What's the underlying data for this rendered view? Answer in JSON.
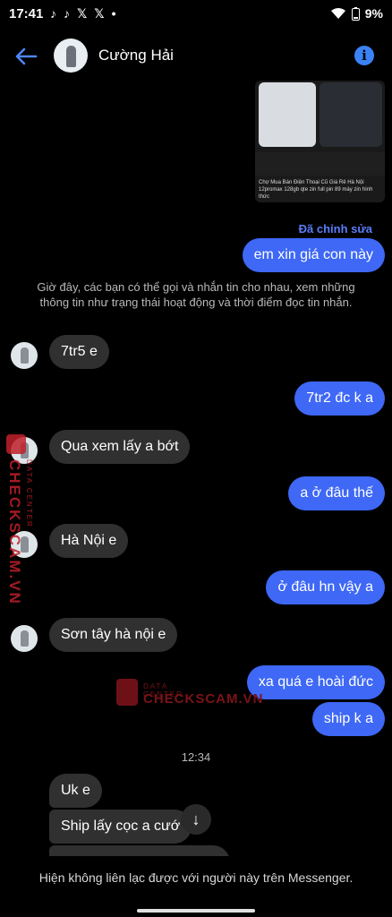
{
  "status_bar": {
    "time": "17:41",
    "left_icons": [
      "tiktok-icon",
      "tiktok-icon",
      "x-icon",
      "x-icon",
      "dot-icon"
    ],
    "battery": "9%"
  },
  "header": {
    "contact_name": "Cường Hải",
    "info_glyph": "i"
  },
  "shared_post": {
    "page_name": "Chợ Mua Bán Điện Thoại Cũ Giá Rẻ Hà Nội",
    "snippet": "12promax 128gb qte zin full pin 89 máy zin hình thức"
  },
  "edited_label": "Đã chỉnh sửa",
  "messages": [
    {
      "side": "out",
      "text": "em xin giá con này"
    },
    {
      "side": "in",
      "text": "7tr5 e"
    },
    {
      "side": "out",
      "text": "7tr2 đc k a"
    },
    {
      "side": "in",
      "text": "Qua xem lấy a bớt"
    },
    {
      "side": "out",
      "text": "a ở đâu thế"
    },
    {
      "side": "in",
      "text": "Hà Nội e"
    },
    {
      "side": "out",
      "text": "ở đâu hn vậy a"
    },
    {
      "side": "in",
      "text": "Sơn tây hà nội e"
    },
    {
      "side": "out",
      "text": "xa quá e hoài đức"
    },
    {
      "side": "out",
      "text": "ship k a"
    },
    {
      "side": "in",
      "text": "Uk e"
    },
    {
      "side": "in",
      "text": "Ship lấy cọc a cướ"
    }
  ],
  "system_note": "Giờ đây, các bạn có thể gọi và nhắn tin cho nhau, xem những thông tin như trạng thái hoạt động và thời điểm đọc tin nhắn.",
  "timestamp": "12:34",
  "footer_text": "Hiện không liên lạc được với người này trên Messenger.",
  "watermark": {
    "brand": "CHECKSCAM.VN",
    "tagline": "DATA CENTER",
    "color": "#c0202a"
  },
  "colors": {
    "outgoing_bubble": "#3e68f5",
    "incoming_bubble": "#303030",
    "accent": "#3b82f6"
  }
}
